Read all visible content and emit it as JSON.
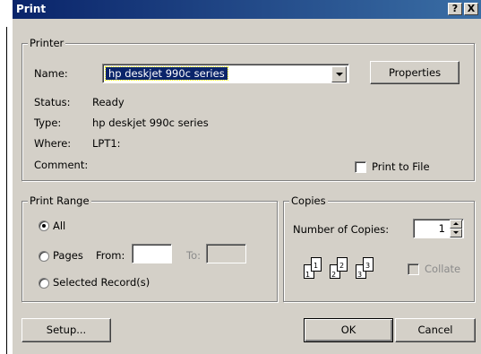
{
  "window": {
    "title": "Print",
    "help_button": "?",
    "close_button": "X"
  },
  "printer": {
    "group_label": "Printer",
    "name_label": "Name:",
    "name_value": "hp deskjet 990c series",
    "properties_button": "Properties",
    "status_label": "Status:",
    "status_value": "Ready",
    "type_label": "Type:",
    "type_value": "hp deskjet 990c series",
    "where_label": "Where:",
    "where_value": "LPT1:",
    "comment_label": "Comment:",
    "print_to_file_label": "Print to File",
    "print_to_file_checked": false
  },
  "print_range": {
    "group_label": "Print Range",
    "all_label": "All",
    "pages_label": "Pages",
    "from_label": "From:",
    "to_label": "To:",
    "from_value": "",
    "to_value": "",
    "selected_label": "Selected Record(s)",
    "selected_option": "All"
  },
  "copies": {
    "group_label": "Copies",
    "number_label": "Number of Copies:",
    "number_value": "1",
    "collate_label": "Collate",
    "collate_checked": false,
    "page_icons": [
      "1",
      "1",
      "2",
      "2",
      "3",
      "3"
    ]
  },
  "buttons": {
    "setup": "Setup...",
    "ok": "OK",
    "cancel": "Cancel"
  }
}
